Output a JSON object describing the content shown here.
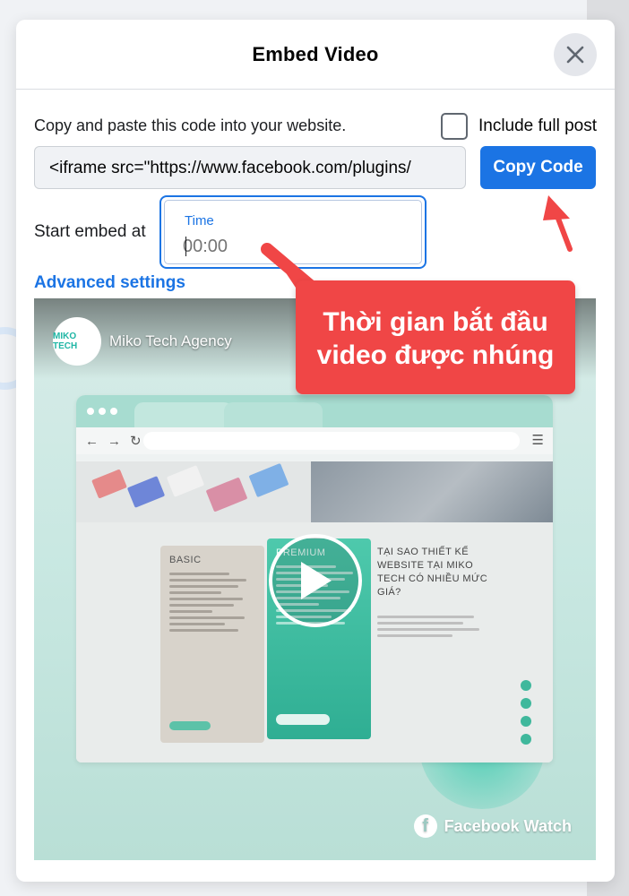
{
  "dialog": {
    "title": "Embed Video",
    "instruction": "Copy and paste this code into your website.",
    "include_full_post_label": "Include full post",
    "include_full_post_checked": false,
    "embed_code": "<iframe src=\"https://www.facebook.com/plugins/",
    "copy_button_label": "Copy Code",
    "start_embed_label": "Start embed at",
    "time_field": {
      "label": "Time",
      "placeholder": "00:00",
      "value": ""
    },
    "advanced_settings_label": "Advanced settings"
  },
  "video": {
    "channel_name": "Miko Tech Agency",
    "channel_logo_text": "MIKO TECH",
    "brand_label": "Facebook Watch",
    "thumbnail": {
      "basic_card_title": "BASIC",
      "premium_card_title": "PREMIUM",
      "why_heading": "TẠI SAO THIẾT KẾ WEBSITE TẠI MIKO TECH CÓ NHIỀU MỨC GIÁ?"
    }
  },
  "annotation": {
    "callout_text": "Thời gian bắt đầu video được nhúng",
    "color": "#f04646"
  },
  "colors": {
    "accent": "#1b74e4",
    "teal": "#2fae93"
  }
}
